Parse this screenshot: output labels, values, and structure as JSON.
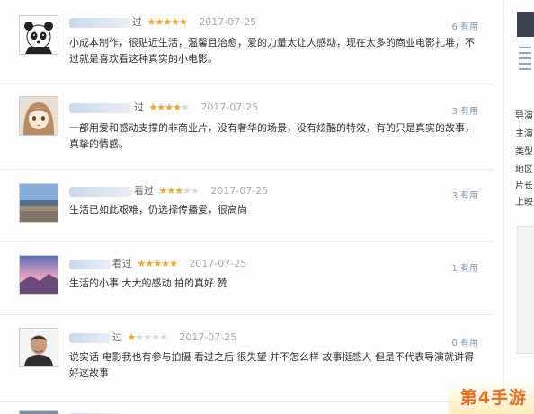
{
  "comments": [
    {
      "author_tail": "过",
      "rating": 5,
      "stars": "★★★★★",
      "date": "2017-07-25",
      "useful": "6 有用",
      "text": "小成本制作，很贴近生活，温馨且治愈，爱的力量太让人感动，现在太多的商业电影扎堆，不过就是喜欢看这种真实的小电影。",
      "avatar_icon": "panda-avatar-icon"
    },
    {
      "author_tail": "过",
      "rating": 4,
      "stars": "★★★★",
      "stars_off": "★",
      "date": "2017-07-25",
      "useful": "3 有用",
      "text": "一部用爱和感动支撑的非商业片，没有奢华的场景，没有炫酷的特效，有的只是真实的故事，真挚的情感。",
      "avatar_icon": "anime-girl-avatar-icon"
    },
    {
      "author_tail": "看过",
      "rating": 3,
      "stars": "★★★",
      "stars_off": "★★",
      "date": "2017-07-25",
      "useful": "3 有用",
      "text": "生活已如此艰难，仍选择传播爱，很高尚",
      "avatar_icon": "landscape-avatar-icon"
    },
    {
      "author_tail": "看过",
      "rating": 5,
      "stars": "★★★★★",
      "date": "2017-07-25",
      "useful": "1 有用",
      "text": "生活的小事 大大的感动 拍的真好 赞",
      "avatar_icon": "sunset-avatar-icon"
    },
    {
      "author_tail": "过",
      "rating": 1,
      "stars": "★",
      "stars_off": "★★★★",
      "date": "2017-07-25",
      "useful": "0 有用",
      "text": "说实话 电影我也有参与拍摄 看过之后 很失望 并不怎么样 故事挺感人 但是不代表导演就讲得好这故事",
      "avatar_icon": "man-portrait-avatar-icon"
    }
  ],
  "sidebar": {
    "lines": [
      {
        "k": "导演",
        "v": ""
      },
      {
        "k": "主演",
        "v": ""
      },
      {
        "k": "类型",
        "v": ""
      },
      {
        "k": "地区",
        "v": ""
      },
      {
        "k": "片长",
        "v": ""
      },
      {
        "k": "上映",
        "v": ""
      }
    ]
  },
  "watermark": {
    "text": "第4手游"
  },
  "colors": {
    "star": "#f5a623",
    "useful": "#7a9ab8",
    "logo": "#f36a10"
  }
}
